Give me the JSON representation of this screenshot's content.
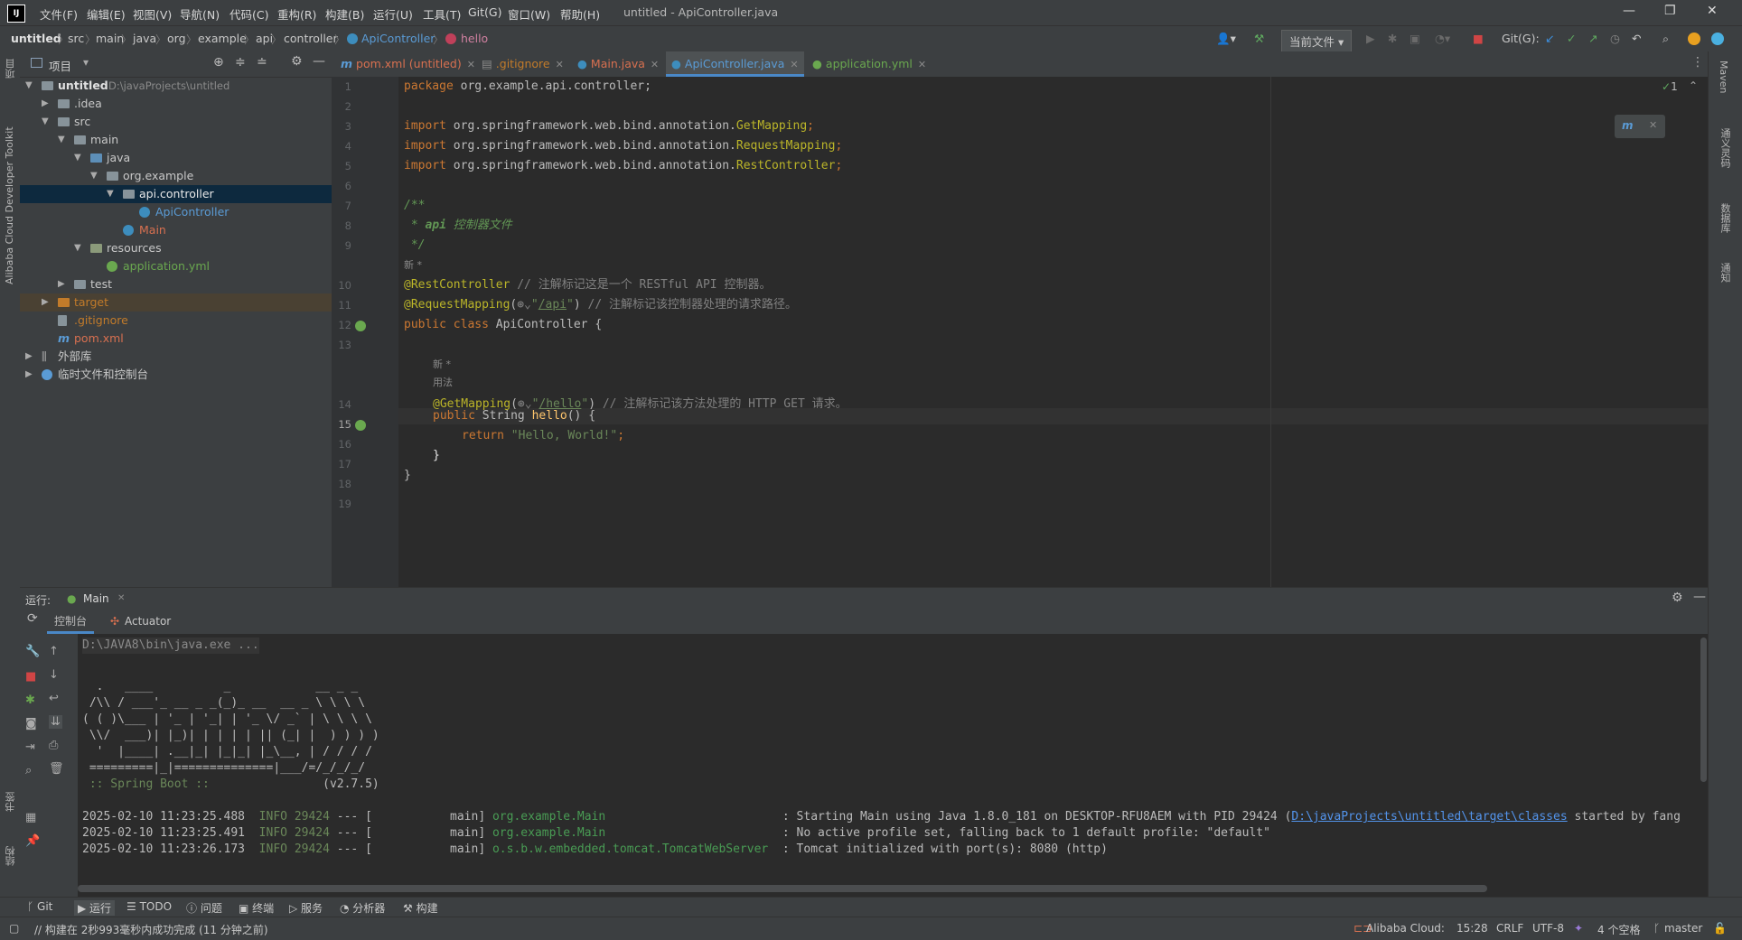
{
  "menu": [
    "文件(F)",
    "编辑(E)",
    "视图(V)",
    "导航(N)",
    "代码(C)",
    "重构(R)",
    "构建(B)",
    "运行(U)",
    "工具(T)",
    "Git(G)",
    "窗口(W)",
    "帮助(H)"
  ],
  "window_title": "untitled - ApiController.java",
  "breadcrumb": [
    "untitled",
    "src",
    "main",
    "java",
    "org",
    "example",
    "api",
    "controller",
    "ApiController",
    "hello"
  ],
  "toolbar": {
    "run_config": "当前文件",
    "git_label": "Git(G):"
  },
  "left_strip": {
    "project_label": "项目",
    "toolkit_label": "Alibaba Cloud Developer Toolkit",
    "bookmarks_label": "书签",
    "structure_label": "结构"
  },
  "right_strip": {
    "maven": "Maven",
    "translate": "通义灵码",
    "database": "数据库",
    "notifications": "通知"
  },
  "project": {
    "title": "项目",
    "tree": [
      {
        "label": "untitled",
        "extra": "D:\\javaProjects\\untitled"
      },
      {
        "label": ".idea"
      },
      {
        "label": "src"
      },
      {
        "label": "main"
      },
      {
        "label": "java"
      },
      {
        "label": "org.example"
      },
      {
        "label": "api.controller"
      },
      {
        "label": "ApiController"
      },
      {
        "label": "Main"
      },
      {
        "label": "resources"
      },
      {
        "label": "application.yml"
      },
      {
        "label": "test"
      },
      {
        "label": "target"
      },
      {
        "label": ".gitignore"
      },
      {
        "label": "pom.xml"
      },
      {
        "label": "外部库"
      },
      {
        "label": "临时文件和控制台"
      }
    ]
  },
  "tabs": [
    "pom.xml (untitled)",
    ".gitignore",
    "Main.java",
    "ApiController.java",
    "application.yml"
  ],
  "editor": {
    "line_numbers": [
      "1",
      "2",
      "3",
      "4",
      "5",
      "6",
      "7",
      "8",
      "9",
      "10",
      "11",
      "12",
      "13",
      "14",
      "15",
      "16",
      "17",
      "18",
      "19"
    ],
    "inspection_count": "1",
    "code": {
      "l1_kw": "package",
      "l1_rest": " org.example.api.controller;",
      "l3_kw": "import",
      "l3_pkg": " org.springframework.web.bind.annotation.",
      "l3_cls": "GetMapping",
      "l3_end": ";",
      "l4_kw": "import",
      "l4_pkg": " org.springframework.web.bind.annotation.",
      "l4_cls": "RequestMapping",
      "l4_end": ";",
      "l5_kw": "import",
      "l5_pkg": " org.springframework.web.bind.annotation.",
      "l5_cls": "RestController",
      "l5_end": ";",
      "l7": "/**",
      "l8_star": " * ",
      "l8_tag": "api",
      "l8_text": " 控制器文件",
      "l9": " */",
      "hint_new": "新 *",
      "l10_ann": "@RestController",
      "l10_cmt": " // 注解标记这是一个 RESTful API 控制器。",
      "l11_ann": "@RequestMapping",
      "l11_open": "(",
      "l11_str1": "\"",
      "l11_path": "/api",
      "l11_str2": "\"",
      "l11_close": ")",
      "l11_cmt": " // 注解标记该控制器处理的请求路径。",
      "l12_kw": "public class",
      "l12_name": " ApiController {",
      "hint_new2": "新 *",
      "hint_usage": "用法",
      "l14_ann": "@GetMapping",
      "l14_open": "(",
      "l14_str1": "\"",
      "l14_path": "/hello",
      "l14_str2": "\"",
      "l14_close": ")",
      "l14_cmt": " // 注解标记该方法处理的 HTTP GET 请求。",
      "l15_kw": "public",
      "l15_type": " String ",
      "l15_fn": "hello",
      "l15_rest": "() {",
      "l16_kw": "return",
      "l16_str": " \"Hello, World!\"",
      "l16_end": ";",
      "l17": "}",
      "l18": "}"
    }
  },
  "run": {
    "label": "运行:",
    "config": "Main",
    "tabs": [
      "控制台",
      "Actuator"
    ],
    "console": {
      "cmd": "D:\\JAVA8\\bin\\java.exe ...",
      "banner": [
        "  .   ____          _            __ _ _",
        " /\\\\ / ___'_ __ _ _(_)_ __  __ _ \\ \\ \\ \\",
        "( ( )\\___ | '_ | '_| | '_ \\/ _` | \\ \\ \\ \\",
        " \\\\/  ___)| |_)| | | | | || (_| |  ) ) ) )",
        "  '  |____| .__|_| |_|_| |_\\__, | / / / /",
        " =========|_|==============|___/=/_/_/_/"
      ],
      "spring_label": " :: Spring Boot :: ",
      "spring_version": "               (v2.7.5)",
      "logs": [
        {
          "ts": "2025-02-10 11:23:25.488",
          "level": "INFO",
          "pid": "29424",
          "sep": "--- [",
          "thread": "           main]",
          "logger": "org.example.Main                        ",
          "msg": ": Starting Main using Java 1.8.0_181 on DESKTOP-RFU8AEM with PID 29424 (",
          "link": "D:\\javaProjects\\untitled\\target\\classes",
          "msg2": " started by fang"
        },
        {
          "ts": "2025-02-10 11:23:25.491",
          "level": "INFO",
          "pid": "29424",
          "sep": "--- [",
          "thread": "           main]",
          "logger": "org.example.Main                        ",
          "msg": ": No active profile set, falling back to 1 default profile: \"default\"",
          "link": "",
          "msg2": ""
        },
        {
          "ts": "2025-02-10 11:23:26.173",
          "level": "INFO",
          "pid": "29424",
          "sep": "--- [",
          "thread": "           main]",
          "logger": "o.s.b.w.embedded.tomcat.TomcatWebServer ",
          "msg": ": Tomcat initialized with port(s): 8080 (http)",
          "link": "",
          "msg2": ""
        }
      ]
    }
  },
  "bottom_tools": [
    "Git",
    "运行",
    "TODO",
    "问题",
    "终端",
    "服务",
    "分析器",
    "构建"
  ],
  "status": {
    "message": "// 构建在 2秒993毫秒内成功完成 (11 分钟之前)",
    "cloud": "Alibaba Cloud:",
    "position": "15:28",
    "line_sep": "CRLF",
    "encoding": "UTF-8",
    "indent": "4 个空格",
    "branch": "master"
  },
  "colors": {
    "accent": "#4a88c7",
    "keyword": "#cc7832",
    "annotation": "#bbb529",
    "string": "#6a8759"
  }
}
